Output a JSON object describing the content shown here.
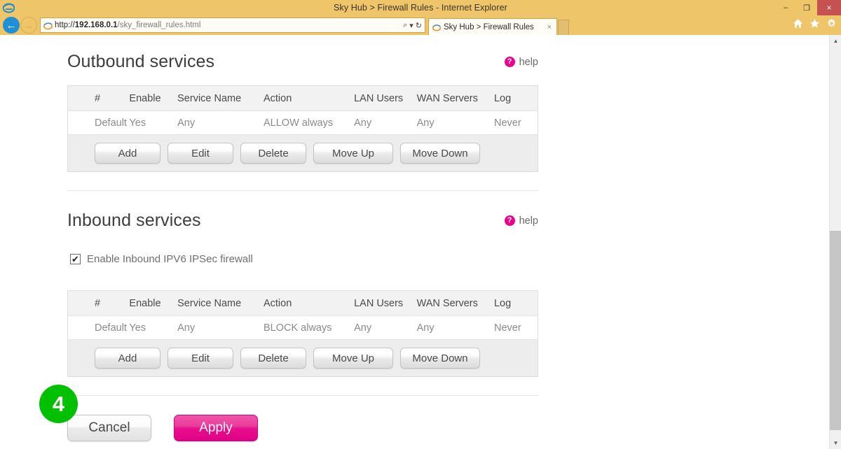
{
  "browser": {
    "window_title": "Sky Hub > Firewall Rules - Internet Explorer",
    "minimize_label": "–",
    "restore_label": "❐",
    "close_label": "×",
    "back_label": "←",
    "forward_label": "→",
    "url_protocol": "http://",
    "url_host": "192.168.0.1",
    "url_path": "/sky_firewall_rules.html",
    "search_icon": "⌕",
    "dropdown_icon": "▾",
    "refresh_icon": "↻",
    "tab_title": "Sky Hub > Firewall Rules",
    "tab_close": "×",
    "home_icon": "home-icon",
    "favorites_icon": "star-icon",
    "settings_icon": "gear-icon"
  },
  "outbound": {
    "title": "Outbound services",
    "help_badge": "?",
    "help_label": "help",
    "columns": [
      "#",
      "Enable",
      "Service Name",
      "Action",
      "LAN Users",
      "WAN Servers",
      "Log"
    ],
    "rows": [
      {
        "num": "Default",
        "enable": "Yes",
        "service": "Any",
        "action": "ALLOW always",
        "lan": "Any",
        "wan": "Any",
        "log": "Never"
      }
    ],
    "buttons": [
      "Add",
      "Edit",
      "Delete",
      "Move Up",
      "Move Down"
    ]
  },
  "inbound": {
    "title": "Inbound services",
    "help_badge": "?",
    "help_label": "help",
    "checkbox_label": "Enable Inbound IPV6 IPSec firewall",
    "checkbox_mark": "✔",
    "checkbox_checked": true,
    "columns": [
      "#",
      "Enable",
      "Service Name",
      "Action",
      "LAN Users",
      "WAN Servers",
      "Log"
    ],
    "rows": [
      {
        "num": "Default",
        "enable": "Yes",
        "service": "Any",
        "action": "BLOCK always",
        "lan": "Any",
        "wan": "Any",
        "log": "Never"
      }
    ],
    "buttons": [
      "Add",
      "Edit",
      "Delete",
      "Move Up",
      "Move Down"
    ],
    "step_badge": "4"
  },
  "footer": {
    "cancel_label": "Cancel",
    "apply_label": "Apply"
  },
  "scrollbar": {
    "up_arrow": "▲",
    "down_arrow": "▼"
  },
  "colors": {
    "chrome": "#eec669",
    "accent_pink": "#ec008c",
    "badge_green": "#00c000",
    "close_red": "#c65151"
  }
}
